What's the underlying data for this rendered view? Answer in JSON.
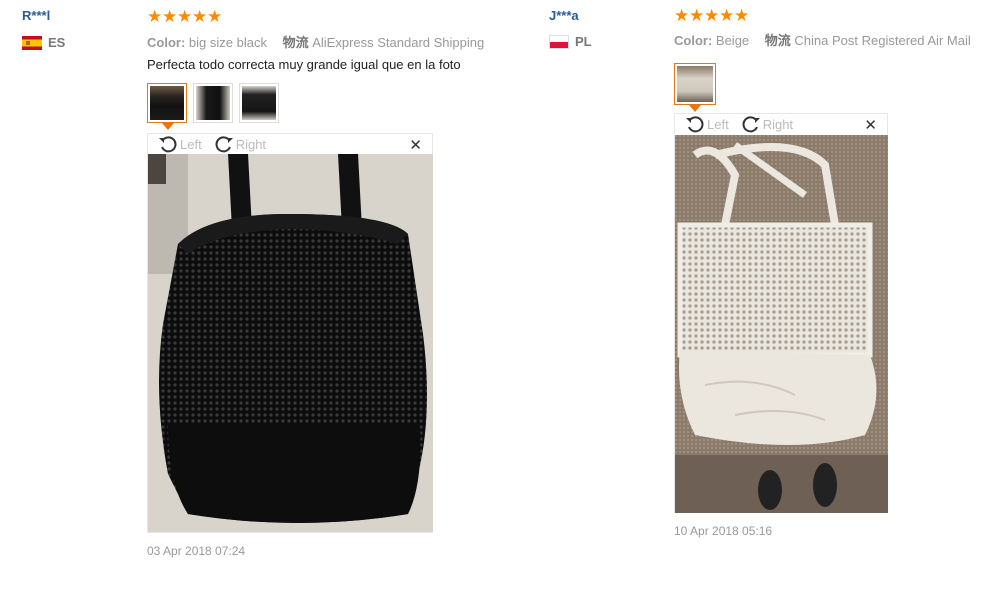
{
  "reviews": [
    {
      "user": "R***l",
      "country_code": "ES",
      "flag_icon": "spain-flag-icon",
      "rating": 5,
      "color_label": "Color:",
      "color_value": "big size black",
      "shipping_label": "物流",
      "shipping_value": "AliExpress Standard Shipping",
      "comment": "Perfecta todo correcta muy grande igual que en la foto",
      "rotate_left": "Left",
      "rotate_right": "Right",
      "close": "✕",
      "date": "03 Apr 2018 07:24"
    },
    {
      "user": "J***a",
      "country_code": "PL",
      "flag_icon": "poland-flag-icon",
      "rating": 5,
      "color_label": "Color:",
      "color_value": "Beige",
      "shipping_label": "物流",
      "shipping_value": "China Post Registered Air Mail",
      "comment": "",
      "rotate_left": "Left",
      "rotate_right": "Right",
      "close": "✕",
      "date": "10 Apr 2018 05:16"
    }
  ],
  "colors": {
    "username": "#2a5a9c",
    "star": "#ff8a00",
    "active_thumb_border": "#e8750f",
    "muted_text": "#999999"
  }
}
